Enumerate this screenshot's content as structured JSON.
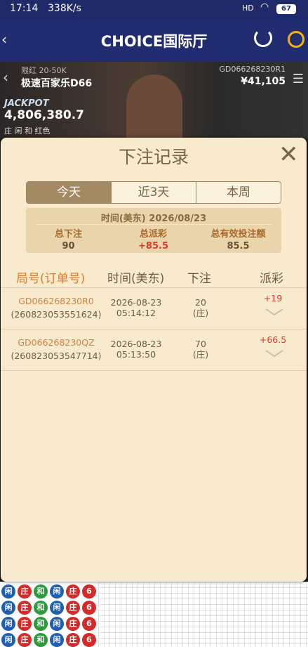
{
  "status_bar": {
    "time": "17:14",
    "network_speed": "338K/s",
    "signal": "HD",
    "battery": "67"
  },
  "header": {
    "back_icon": "chevron-left-icon",
    "title": "CHOICE国际厅",
    "refresh_icon": "refresh-icon",
    "support_icon": "customer-service-icon"
  },
  "video": {
    "limit": "限红 20-50K",
    "table_name": "极速百家乐D66",
    "game_id": "GD066268230R1",
    "balance": "¥41,105",
    "jackpot_label": "JACKPOT",
    "jackpot_value": "4,806,380.7",
    "bet_types": "庄 闲 和 红色"
  },
  "modal": {
    "title": "下注记录",
    "close_icon": "close-icon",
    "tabs": [
      {
        "label": "今天",
        "active": true
      },
      {
        "label": "近3天",
        "active": false
      },
      {
        "label": "本周",
        "active": false
      }
    ],
    "summary": {
      "date_label": "时间(美东)  2026/08/23",
      "total_bet_label": "总下注",
      "total_bet_value": "90",
      "total_payout_label": "总派彩",
      "total_payout_value": "+85.5",
      "valid_bet_label": "总有效投注额",
      "valid_bet_value": "85.5"
    },
    "columns": {
      "order": "局号(订单号)",
      "time": "时间(美东)",
      "bet": "下注",
      "payout": "派彩"
    },
    "rows": [
      {
        "order_id": "GD066268230R0",
        "ticket": "(260823053551624)",
        "date": "2026-08-23",
        "time": "05:14:12",
        "bet_amount": "20",
        "bet_side": "(庄)",
        "payout": "+19"
      },
      {
        "order_id": "GD066268230QZ",
        "ticket": "(260823053547714)",
        "date": "2026-08-23",
        "time": "05:13:50",
        "bet_amount": "70",
        "bet_side": "(庄)",
        "payout": "+66.5"
      }
    ]
  },
  "road": {
    "beads": [
      {
        "label": "闲",
        "color": "#1e5fb4"
      },
      {
        "label": "庄",
        "color": "#d42a2a"
      },
      {
        "label": "和",
        "color": "#2a9a3a"
      },
      {
        "label": "闲",
        "color": "#1e5fb4"
      },
      {
        "label": "庄",
        "color": "#d42a2a"
      },
      {
        "label": "6",
        "color": "#d42a2a"
      }
    ]
  },
  "colors": {
    "header_bg": "#222c70",
    "modal_bg": "#f8ebcd",
    "accent_brown": "#a48a63",
    "payout_red": "#d63a2a",
    "order_orange": "#d08040"
  }
}
